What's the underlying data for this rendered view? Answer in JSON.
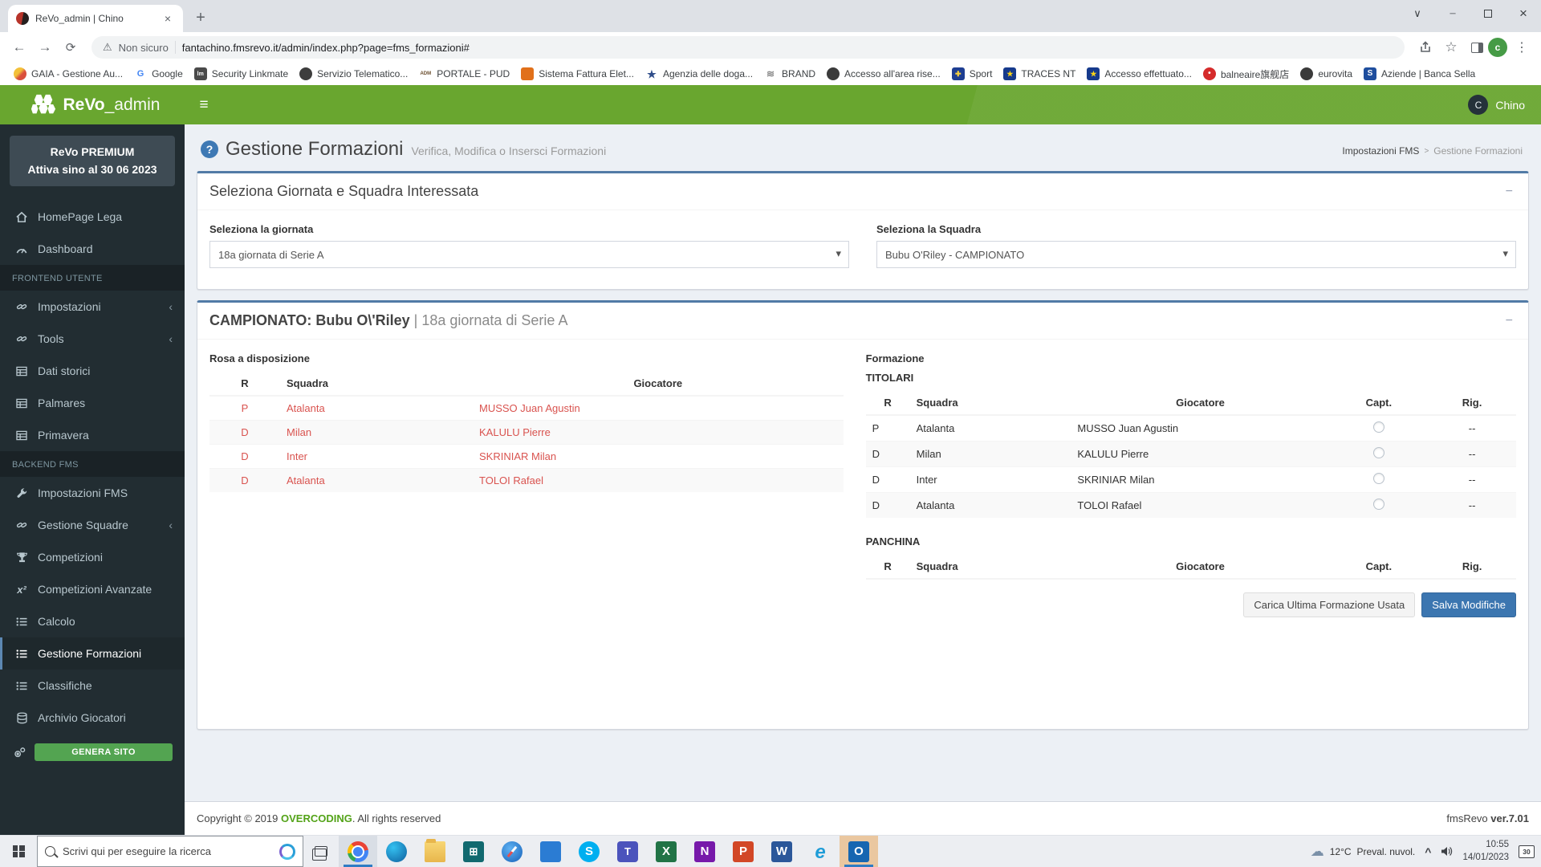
{
  "browser": {
    "tab_title": "ReVo_admin | Chino",
    "security_label": "Non sicuro",
    "url": "fantachino.fmsrevo.it/admin/index.php?page=fms_formazioni#",
    "profile_initial": "c",
    "bookmarks": [
      {
        "label": "GAIA - Gestione Au...",
        "glyph": "",
        "icon_style": "background:linear-gradient(135deg,#f3c13a 40%,#d94f3d 60%);border-radius:50%"
      },
      {
        "label": "Google",
        "glyph": "G",
        "icon_style": "background:#fff;color:#4285f4;font-size:11px"
      },
      {
        "label": "Security Linkmate",
        "glyph": "lm",
        "icon_style": "background:#4a4a4a;color:#fff;font-size:7px"
      },
      {
        "label": "Servizio Telematico...",
        "glyph": "",
        "icon_style": "background:#3d3d3d;border-radius:50%"
      },
      {
        "label": "PORTALE - PUD",
        "glyph": "ADM",
        "icon_style": "background:transparent;color:#6b4e2e;font-size:6px"
      },
      {
        "label": "Sistema Fattura Elet...",
        "glyph": "",
        "icon_style": "background:#e1701a"
      },
      {
        "label": "Agenzia delle doga...",
        "glyph": "★",
        "icon_style": "background:transparent;color:#2f4d8a;font-size:13px"
      },
      {
        "label": "BRAND",
        "glyph": "≋",
        "icon_style": "background:transparent;color:#8a8a8a;font-size:12px"
      },
      {
        "label": "Accesso all'area rise...",
        "glyph": "",
        "icon_style": "background:#3b3b3b;border-radius:50%"
      },
      {
        "label": "Sport",
        "glyph": "✚",
        "icon_style": "background:#1e3e92;color:#f4d03f;font-size:9px"
      },
      {
        "label": "TRACES NT",
        "glyph": "★",
        "icon_style": "background:#163a8c;color:#ffd617;font-size:9px"
      },
      {
        "label": "Accesso effettuato...",
        "glyph": "★",
        "icon_style": "background:#163a8c;color:#ffd617;font-size:9px"
      },
      {
        "label": "balneaire旗舰店",
        "glyph": "•",
        "icon_style": "background:#d52b2b;color:#fff;border-radius:50%;font-size:10px"
      },
      {
        "label": "eurovita",
        "glyph": "",
        "icon_style": "background:#3b3b3b;border-radius:50%"
      },
      {
        "label": "Aziende | Banca Sella",
        "glyph": "S",
        "icon_style": "background:#1f4e9e;color:#fff;font-size:10px"
      }
    ]
  },
  "header": {
    "logo_bold": "ReVo",
    "logo_rest": "_admin",
    "user_initial": "C",
    "user_name": "Chino"
  },
  "sidebar": {
    "premium_line1": "ReVo PREMIUM",
    "premium_line2": "Attiva sino al 30 06 2023",
    "items": [
      {
        "kind": "item",
        "icon": "home",
        "label": "HomePage Lega"
      },
      {
        "kind": "item",
        "icon": "gauge",
        "label": "Dashboard"
      },
      {
        "kind": "section",
        "label": "FRONTEND UTENTE"
      },
      {
        "kind": "item",
        "icon": "link",
        "label": "Impostazioni",
        "chevron": true
      },
      {
        "kind": "item",
        "icon": "link",
        "label": "Tools",
        "chevron": true
      },
      {
        "kind": "item",
        "icon": "table",
        "label": "Dati storici"
      },
      {
        "kind": "item",
        "icon": "table",
        "label": "Palmares"
      },
      {
        "kind": "item",
        "icon": "table",
        "label": "Primavera"
      },
      {
        "kind": "section",
        "label": "BACKEND FMS"
      },
      {
        "kind": "item",
        "icon": "wrench",
        "label": "Impostazioni FMS"
      },
      {
        "kind": "item",
        "icon": "link",
        "label": "Gestione Squadre",
        "chevron": true
      },
      {
        "kind": "item",
        "icon": "trophy",
        "label": "Competizioni"
      },
      {
        "kind": "item",
        "icon": "x2",
        "label": "Competizioni Avanzate"
      },
      {
        "kind": "item",
        "icon": "list",
        "label": "Calcolo"
      },
      {
        "kind": "item",
        "icon": "list",
        "label": "Gestione Formazioni",
        "active": true
      },
      {
        "kind": "item",
        "icon": "list",
        "label": "Classifiche"
      },
      {
        "kind": "item",
        "icon": "db",
        "label": "Archivio Giocatori"
      }
    ],
    "generate_label": "GENERA SITO"
  },
  "page": {
    "title": "Gestione Formazioni",
    "subtitle": "Verifica, Modifica o Insersci Formazioni",
    "breadcrumb": [
      "Impostazioni FMS",
      "Gestione Formazioni"
    ],
    "panel1": {
      "title": "Seleziona Giornata e Squadra Interessata",
      "giornata_label": "Seleziona la giornata",
      "giornata_value": "18a giornata di Serie A",
      "squadra_label": "Seleziona la Squadra",
      "squadra_value": "Bubu O'Riley - CAMPIONATO"
    },
    "panel2": {
      "title_bold": "CAMPIONATO: Bubu O\\'Riley",
      "title_rest": "| 18a giornata di Serie A",
      "rosa_title": "Rosa a disposizione",
      "rosa_headers": {
        "r": "R",
        "squadra": "Squadra",
        "giocatore": "Giocatore"
      },
      "rosa_rows": [
        {
          "r": "P",
          "squadra": "Atalanta",
          "giocatore": "MUSSO Juan Agustin"
        },
        {
          "r": "D",
          "squadra": "Milan",
          "giocatore": "KALULU Pierre"
        },
        {
          "r": "D",
          "squadra": "Inter",
          "giocatore": "SKRINIAR Milan"
        },
        {
          "r": "D",
          "squadra": "Atalanta",
          "giocatore": "TOLOI Rafael"
        }
      ],
      "formazione_title": "Formazione",
      "titolari_title": "TITOLARI",
      "form_headers": {
        "r": "R",
        "squadra": "Squadra",
        "giocatore": "Giocatore",
        "capt": "Capt.",
        "rig": "Rig."
      },
      "titolari_rows": [
        {
          "r": "P",
          "squadra": "Atalanta",
          "giocatore": "MUSSO Juan Agustin",
          "rig": "--"
        },
        {
          "r": "D",
          "squadra": "Milan",
          "giocatore": "KALULU Pierre",
          "rig": "--"
        },
        {
          "r": "D",
          "squadra": "Inter",
          "giocatore": "SKRINIAR Milan",
          "rig": "--"
        },
        {
          "r": "D",
          "squadra": "Atalanta",
          "giocatore": "TOLOI Rafael",
          "rig": "--"
        }
      ],
      "panchina_title": "PANCHINA",
      "load_button": "Carica Ultima Formazione Usata",
      "save_button": "Salva Modifiche"
    }
  },
  "footer": {
    "copyright_prefix": "Copyright © 2019 ",
    "brand": "OVERCODING",
    "copyright_suffix": ". All rights reserved",
    "version_prefix": "fmsRevo ",
    "version": "ver.7.01"
  },
  "taskbar": {
    "search_placeholder": "Scrivi qui per eseguire la ricerca",
    "apps": [
      {
        "kind": "chrome",
        "name": "chrome-icon",
        "active": true
      },
      {
        "kind": "edge",
        "name": "edge-icon"
      },
      {
        "kind": "explorer",
        "name": "file-explorer-icon"
      },
      {
        "kind": "store",
        "name": "microsoft-store-icon",
        "letter": "⊞"
      },
      {
        "kind": "safari",
        "name": "compass-browser-icon"
      },
      {
        "kind": "tiles",
        "name": "app-grid-icon"
      },
      {
        "kind": "skype",
        "name": "skype-icon",
        "letter": "S"
      },
      {
        "kind": "teams",
        "name": "teams-icon",
        "letter": "T"
      },
      {
        "kind": "excel",
        "name": "excel-icon",
        "letter": "X"
      },
      {
        "kind": "onenote",
        "name": "onenote-icon",
        "letter": "N"
      },
      {
        "kind": "powerpoint",
        "name": "powerpoint-icon",
        "letter": "P"
      },
      {
        "kind": "word",
        "name": "word-icon",
        "letter": "W"
      },
      {
        "kind": "ie",
        "name": "internet-explorer-icon",
        "letter": "e"
      },
      {
        "kind": "outlook",
        "name": "outlook-icon",
        "letter": "O",
        "active": true,
        "attention": true
      }
    ],
    "weather_temp": "12°C",
    "weather_condition": "Preval. nuvol.",
    "time": "10:55",
    "date": "14/01/2023",
    "notification_count": "30"
  }
}
